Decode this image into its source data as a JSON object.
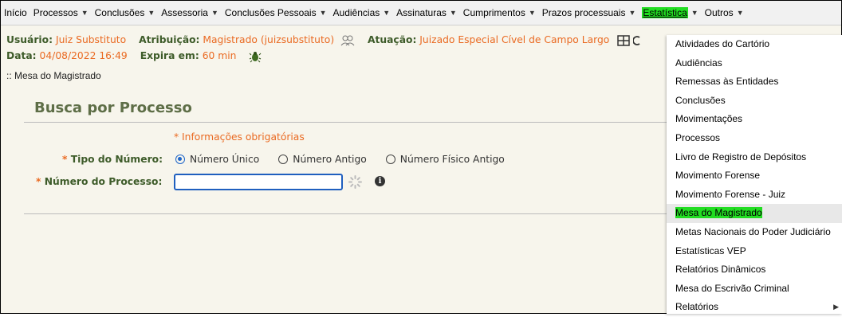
{
  "menu": [
    {
      "label": "Início",
      "caret": false
    },
    {
      "label": "Processos",
      "caret": true
    },
    {
      "label": "Conclusões",
      "caret": true
    },
    {
      "label": "Assessoria",
      "caret": true
    },
    {
      "label": "Conclusões Pessoais",
      "caret": true
    },
    {
      "label": "Audiências",
      "caret": true
    },
    {
      "label": "Assinaturas",
      "caret": true
    },
    {
      "label": "Cumprimentos",
      "caret": true
    },
    {
      "label": "Prazos processuais",
      "caret": true
    },
    {
      "label": "Estatística",
      "caret": true,
      "active": true
    },
    {
      "label": "Outros",
      "caret": true
    }
  ],
  "info": {
    "usuario_label": "Usuário:",
    "usuario_value": "Juiz Substituto",
    "atribuicao_label": "Atribuição:",
    "atribuicao_value": "Magistrado (juizsubstituto)",
    "atuacao_label": "Atuação:",
    "atuacao_value": "Juizado Especial Cível de Campo Largo",
    "data_label": "Data:",
    "data_value": "04/08/2022 16:49",
    "expira_label": "Expira em:",
    "expira_value": "60 min"
  },
  "breadcrumb": ":: Mesa do Magistrado",
  "form": {
    "title": "Busca por Processo",
    "required_note": "* Informações obrigatórias",
    "tipo_label": "Tipo do Número:",
    "numero_label": "Número do Processo:",
    "star": "*",
    "radios": [
      {
        "label": "Número Único",
        "checked": true
      },
      {
        "label": "Número Antigo",
        "checked": false
      },
      {
        "label": "Número Físico Antigo",
        "checked": false
      }
    ],
    "numero_value": ""
  },
  "dropdown": [
    {
      "label": "Atividades do Cartório"
    },
    {
      "label": "Audiências"
    },
    {
      "label": "Remessas às Entidades"
    },
    {
      "label": "Conclusões"
    },
    {
      "label": "Movimentações"
    },
    {
      "label": "Processos"
    },
    {
      "label": "Livro de Registro de Depósitos"
    },
    {
      "label": "Movimento Forense"
    },
    {
      "label": "Movimento Forense - Juiz"
    },
    {
      "label": "Mesa do Magistrado",
      "highlight": true
    },
    {
      "label": "Metas Nacionais do Poder Judiciário"
    },
    {
      "label": "Estatísticas VEP"
    },
    {
      "label": "Relatórios Dinâmicos"
    },
    {
      "label": "Mesa do Escrivão Criminal"
    },
    {
      "label": "Relatórios",
      "submenu": true
    }
  ],
  "colors": {
    "label_green": "#3d5b29",
    "value_orange": "#ea6a22",
    "highlight": "#22dd22",
    "focus_blue": "#1f5fbf"
  }
}
